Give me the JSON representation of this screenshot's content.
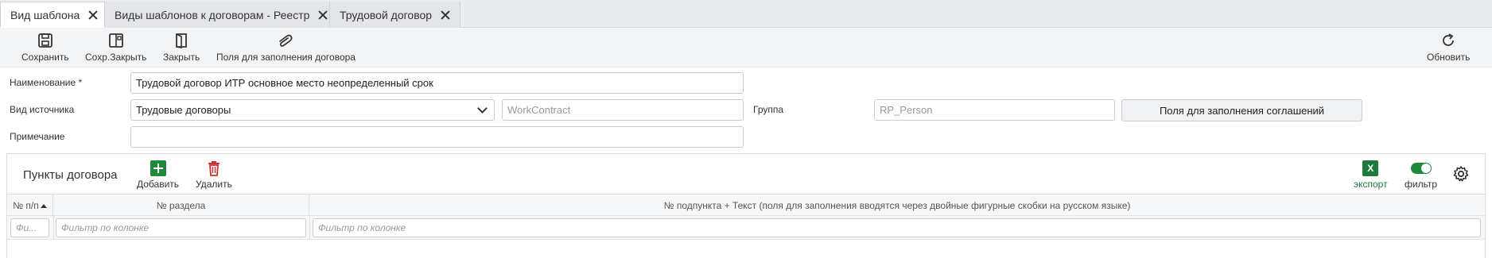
{
  "tabs": [
    {
      "label": "Вид шаблона",
      "active": true
    },
    {
      "label": "Виды шаблонов к договорам - Реестр",
      "active": false
    },
    {
      "label": "Трудовой договор",
      "active": false
    }
  ],
  "toolbar": {
    "save": "Сохранить",
    "save_close": "Сохр.Закрыть",
    "close": "Закрыть",
    "contract_fields": "Поля для заполнения договора",
    "refresh": "Обновить"
  },
  "form": {
    "name_label": "Наименование *",
    "name_value": "Трудовой договор ИТР основное  место неопределенный срок",
    "source_label": "Вид источника",
    "source_value": "Трудовые договоры",
    "source_code": "WorkContract",
    "group_label": "Группа",
    "group_value": "RP_Person",
    "agreement_fields_button": "Поля для заполнения соглашений",
    "note_label": "Примечание",
    "note_value": ""
  },
  "panel": {
    "title": "Пункты договора",
    "add": "Добавить",
    "delete": "Удалить",
    "export_icon": "X",
    "export": "экспорт",
    "filter": "фильтр"
  },
  "grid": {
    "columns": [
      "№ п/п",
      "№ раздела",
      "№ подпункта + Текст (поля для заполнения вводятся через двойные фигурные скобки на русском языке)"
    ],
    "filter_placeholder_short": "Фи...",
    "filter_placeholder": "Фильтр по колонке"
  },
  "colors": {
    "accent_green": "#1e8a3a",
    "delete_red": "#d0302f",
    "export_green": "#1e7a3a"
  }
}
